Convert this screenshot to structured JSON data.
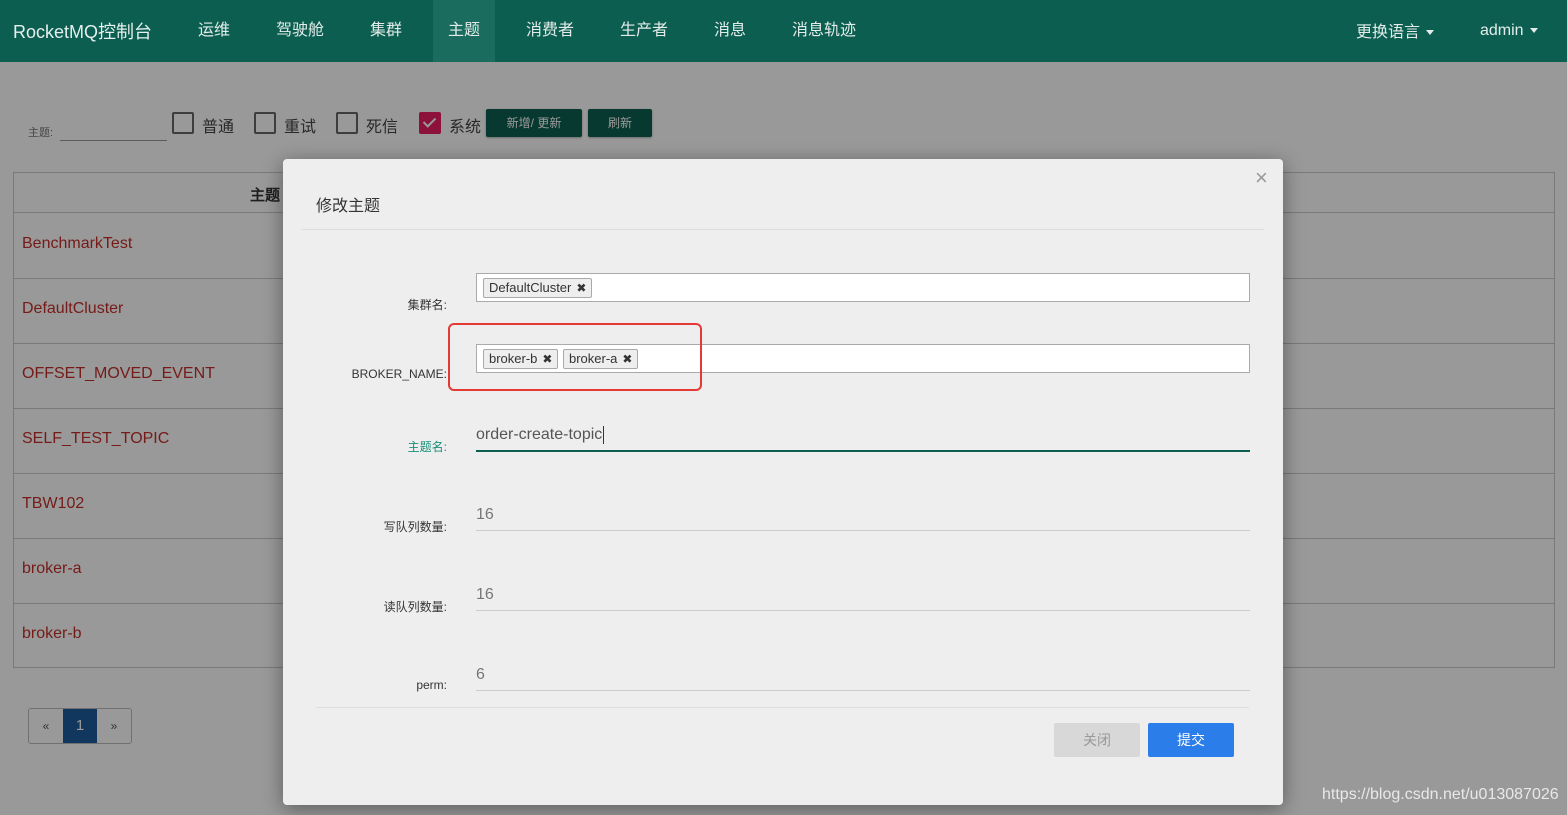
{
  "navbar": {
    "brand": "RocketMQ控制台",
    "items": [
      "运维",
      "驾驶舱",
      "集群",
      "主题",
      "消费者",
      "生产者",
      "消息",
      "消息轨迹"
    ],
    "active_item": "主题",
    "language": "更换语言",
    "user": "admin"
  },
  "filter": {
    "topic_label": "主题:",
    "checkboxes": [
      {
        "label": "普通",
        "checked": false
      },
      {
        "label": "重试",
        "checked": false
      },
      {
        "label": "死信",
        "checked": false
      },
      {
        "label": "系统",
        "checked": true
      }
    ],
    "add_update_button": "新增/ 更新",
    "refresh_button": "刷新"
  },
  "table": {
    "header": "主题",
    "rows": [
      "BenchmarkTest",
      "DefaultCluster",
      "OFFSET_MOVED_EVENT",
      "SELF_TEST_TOPIC",
      "TBW102",
      "broker-a",
      "broker-b"
    ]
  },
  "pagination": {
    "prev": "«",
    "current": "1",
    "next": "»"
  },
  "modal": {
    "title": "修改主题",
    "close_icon": "×",
    "cluster_label": "集群名:",
    "cluster_tags": [
      "DefaultCluster"
    ],
    "broker_label": "BROKER_NAME:",
    "broker_tags": [
      "broker-b",
      "broker-a"
    ],
    "topic_label": "主题名:",
    "topic_value": "order-create-topic",
    "write_queue_label": "写队列数量:",
    "write_queue_value": "16",
    "read_queue_label": "读队列数量:",
    "read_queue_value": "16",
    "perm_label": "perm:",
    "perm_value": "6",
    "close_button": "关闭",
    "submit_button": "提交",
    "tag_remove_glyph": "✖"
  },
  "watermark": "https://blog.csdn.net/u013087026",
  "colors": {
    "primary": "#0c5f50",
    "link": "#c4302b",
    "submit": "#2b7de9",
    "highlight": "#e53935",
    "checkbox_checked": "#e91e63"
  }
}
